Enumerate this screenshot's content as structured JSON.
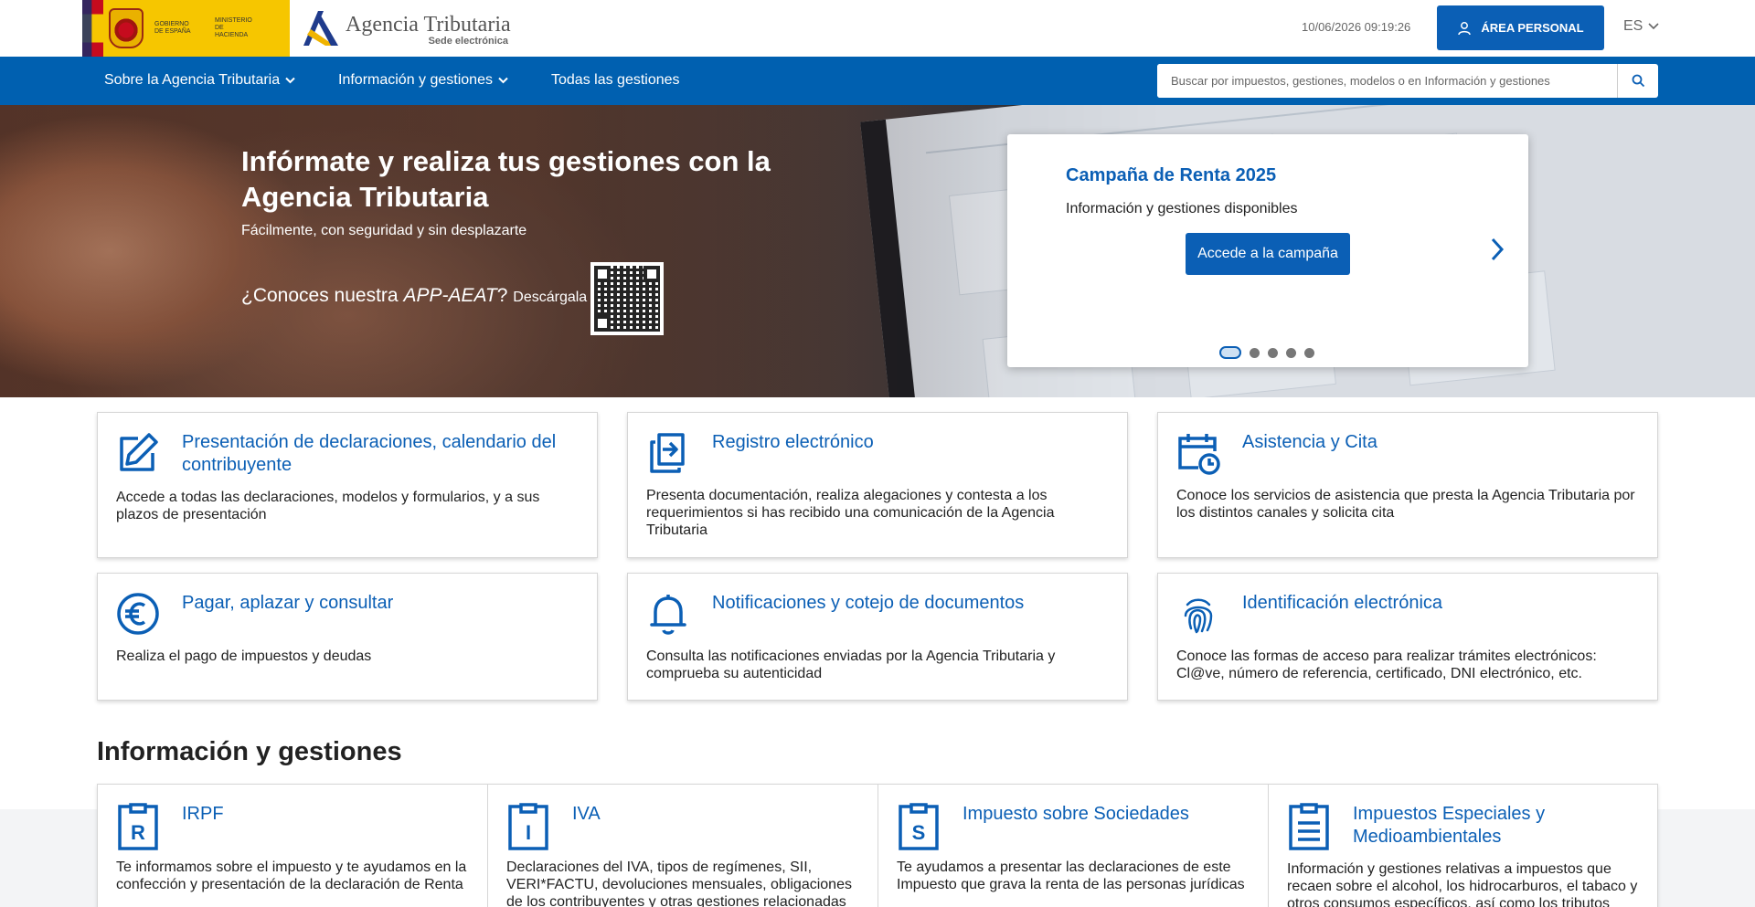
{
  "header": {
    "gov_text_1": "Gobierno de España",
    "gov_text_2": "Ministerio de Hacienda",
    "agency_name": "Agencia Tributaria",
    "agency_sub": "Sede electrónica",
    "datetime": "10/06/2026 09:19:26",
    "area_personal_label": "ÁREA PERSONAL",
    "language": "ES"
  },
  "nav": {
    "items": [
      {
        "label": "Sobre la Agencia Tributaria"
      },
      {
        "label": "Información y gestiones"
      },
      {
        "label": "Todas las gestiones"
      }
    ],
    "search_placeholder": "Buscar por impuestos, gestiones, modelos o en Información y gestiones"
  },
  "hero": {
    "title": "Infórmate y realiza tus gestiones con la Agencia Tributaria",
    "subtitle": "Fácilmente, con seguridad y sin desplazarte",
    "app_question_prefix": "¿Conoces nuestra ",
    "app_name": "APP-AEAT",
    "app_question_suffix": "? ",
    "download_label": "Descárgala",
    "campaign": {
      "title": "Campaña de Renta 2025",
      "text": "Información y gestiones disponibles",
      "button_label": "Accede a la campaña"
    },
    "slides_count": 5,
    "active_slide": 1
  },
  "cards": [
    {
      "title": "Presentación de declaraciones, calendario del contribuyente",
      "text": "Accede a todas las declaraciones, modelos y formularios, y a sus plazos de presentación",
      "icon": "edit-icon"
    },
    {
      "title": "Registro electrónico",
      "text": "Presenta documentación, realiza alegaciones y contesta a los requerimientos si has recibido una comunicación de la Agencia Tributaria",
      "icon": "register-icon"
    },
    {
      "title": "Asistencia y Cita",
      "text": "Conoce los servicios de asistencia que presta la Agencia Tributaria por los distintos canales y solicita cita",
      "icon": "calendar-clock-icon"
    },
    {
      "title": "Pagar, aplazar y consultar",
      "text": "Realiza el pago de impuestos y deudas",
      "icon": "euro-icon"
    },
    {
      "title": "Notificaciones y cotejo de documentos",
      "text": "Consulta las notificaciones enviadas por la Agencia Tributaria y comprueba su autenticidad",
      "icon": "bell-icon"
    },
    {
      "title": "Identificación electrónica",
      "text": "Conoce las formas de acceso para realizar trámites electrónicos: Cl@ve, número de referencia, certificado, DNI electrónico, etc.",
      "icon": "fingerprint-icon"
    }
  ],
  "info_section": {
    "title": "Información y gestiones",
    "items": [
      {
        "title": "IRPF",
        "text": "Te informamos sobre el impuesto y te ayudamos en la confección y presentación de la declaración de Renta",
        "icon_letter": "R"
      },
      {
        "title": "IVA",
        "text": "Declaraciones del IVA, tipos de regímenes, SII, VERI*FACTU, devoluciones mensuales, obligaciones de los contribuyentes y otras gestiones relacionadas",
        "icon_letter": "I"
      },
      {
        "title": "Impuesto sobre Sociedades",
        "text": "Te ayudamos a presentar las declaraciones de este Impuesto que grava la renta de las personas jurídicas",
        "icon_letter": "S"
      },
      {
        "title": "Impuestos Especiales y Medioambientales",
        "text": "Información y gestiones relativas a impuestos que recaen sobre el alcohol, los hidrocarburos, el tabaco y otros consumos específicos, así como los tributos",
        "icon_letter": ""
      }
    ]
  },
  "colors": {
    "brand_blue": "#0b5fb5",
    "nav_blue": "#0060b0",
    "gov_yellow": "#f6c600"
  }
}
